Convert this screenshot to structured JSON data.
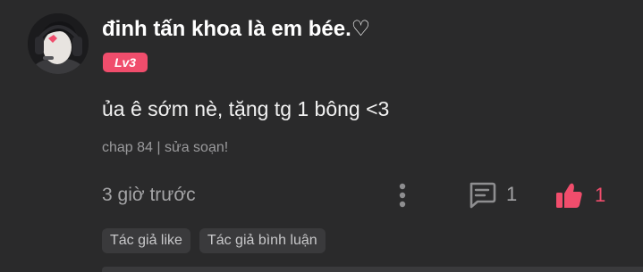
{
  "comment": {
    "username": "đinh tấn khoa là em bée.♡",
    "level": "Lv3",
    "text": "ủa ê sớm nè, tặng tg 1 bông <3",
    "chapter_ref": "chap 84 | sửa soạn!",
    "timestamp": "3 giờ trước",
    "reply_count": "1",
    "like_count": "1",
    "tags": [
      "Tác giả like",
      "Tác giả bình luận"
    ]
  },
  "colors": {
    "background": "#2a2a2b",
    "accent": "#f04d6c",
    "muted_text": "#a4a4a6",
    "tag_background": "#3a3a3c"
  },
  "icons": {
    "more": "vertical-dots-icon",
    "reply": "comment-icon",
    "like": "thumbs-up-icon"
  }
}
